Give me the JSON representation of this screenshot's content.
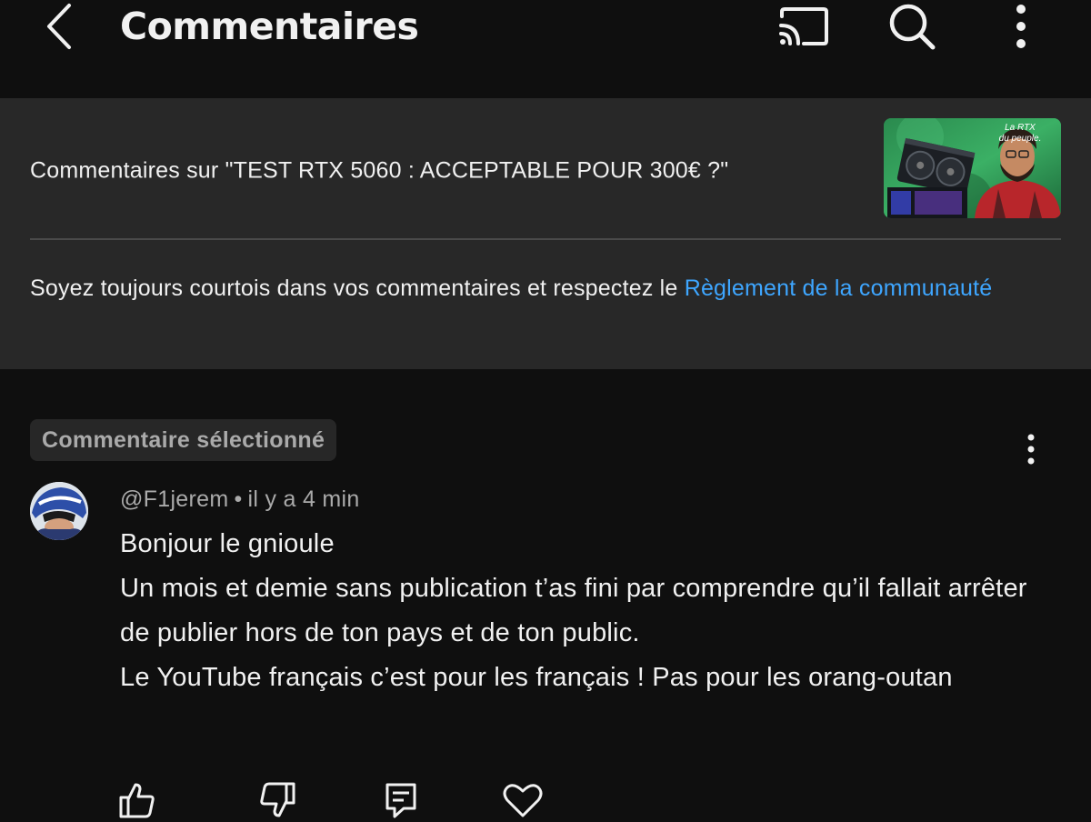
{
  "header": {
    "title": "Commentaires",
    "back_icon": "chevron-left-icon",
    "cast_icon": "cast-icon",
    "search_icon": "search-icon",
    "more_icon": "more-vertical-icon"
  },
  "video": {
    "comments_on": "Commentaires sur \"TEST RTX 5060 : ACCEPTABLE POUR 300€ ?\"",
    "thumbnail_text": "La RTX du peuple."
  },
  "guidelines": {
    "text": "Soyez toujours courtois dans vos commentaires et respectez le ",
    "link": "Règlement de la communauté"
  },
  "comment": {
    "badge": "Commentaire sélectionné",
    "author": "@F1jerem",
    "separator": "•",
    "time": "il y a 4 min",
    "lines": [
      "Bonjour le gnioule",
      "Un mois et demie sans publication t’as fini par comprendre qu’il fallait arrêter de publier hors de ton pays et de ton public.",
      "Le YouTube français c’est pour les français ! Pas pour les orang-outan"
    ],
    "actions": [
      "like-icon",
      "dislike-icon",
      "reply-icon",
      "heart-icon"
    ]
  },
  "colors": {
    "background": "#0f0f0f",
    "panel": "#282828",
    "text": "#f1f1f1",
    "secondary_text": "#aaaaaa",
    "link": "#3ea6ff"
  }
}
